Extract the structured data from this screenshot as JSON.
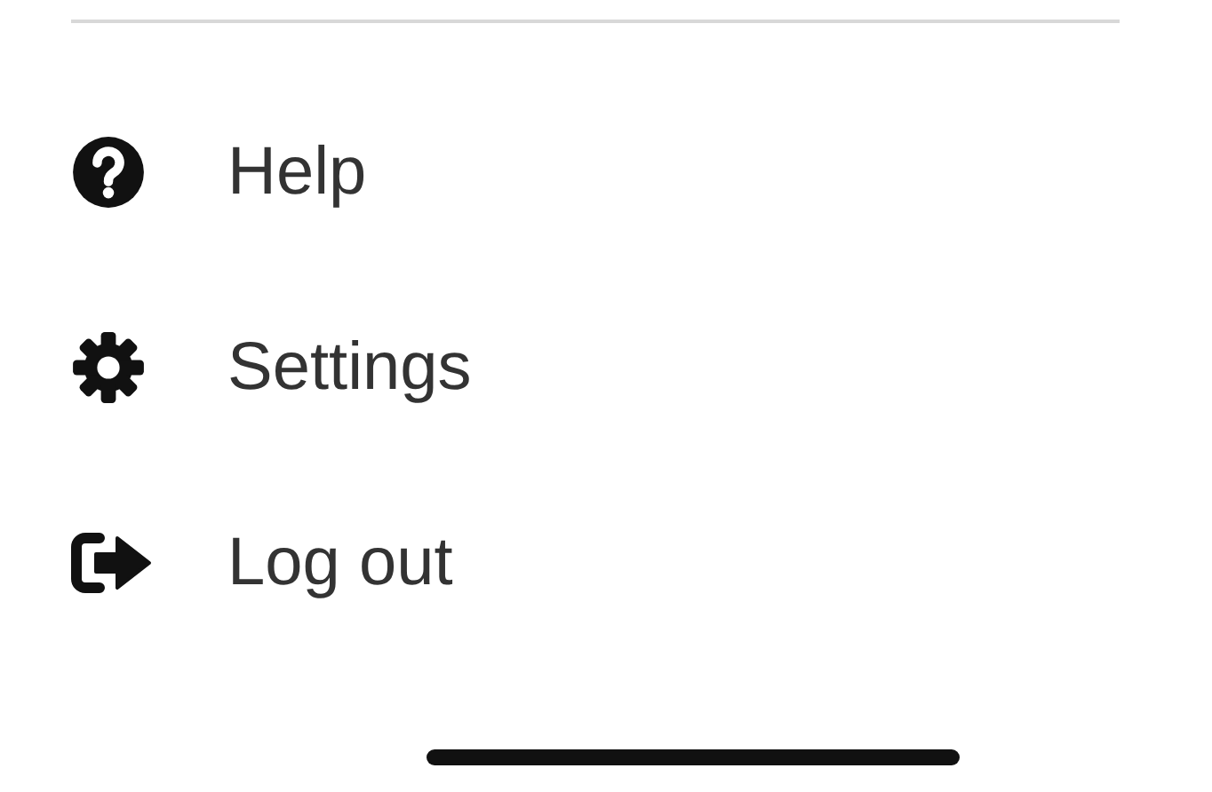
{
  "menu": [
    {
      "kind": "help",
      "label": "Help"
    },
    {
      "kind": "settings",
      "label": "Settings"
    },
    {
      "kind": "logout",
      "label": "Log out"
    }
  ]
}
